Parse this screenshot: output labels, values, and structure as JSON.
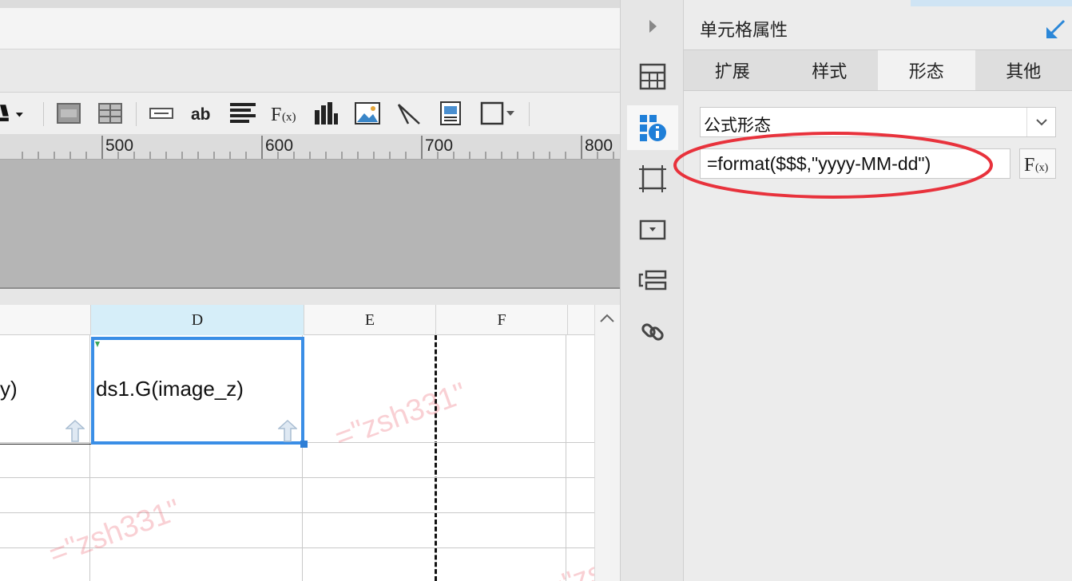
{
  "ruler": {
    "ticks": [
      "500",
      "600",
      "700",
      "800"
    ]
  },
  "sheet": {
    "columns": [
      "D",
      "E",
      "F"
    ],
    "cells": {
      "c_partial": "y)",
      "d1": "ds1.G(image_z)"
    },
    "watermark": "=\"zsh331\""
  },
  "panel": {
    "title": "单元格属性",
    "tabs": [
      "扩展",
      "样式",
      "形态",
      "其他"
    ],
    "active_tab": "形态",
    "form_type": "公式形态",
    "formula": "=format($$$,\"yyyy-MM-dd\")"
  },
  "colors": {
    "accent": "#3a8ee6",
    "highlight": "#e8323c"
  }
}
